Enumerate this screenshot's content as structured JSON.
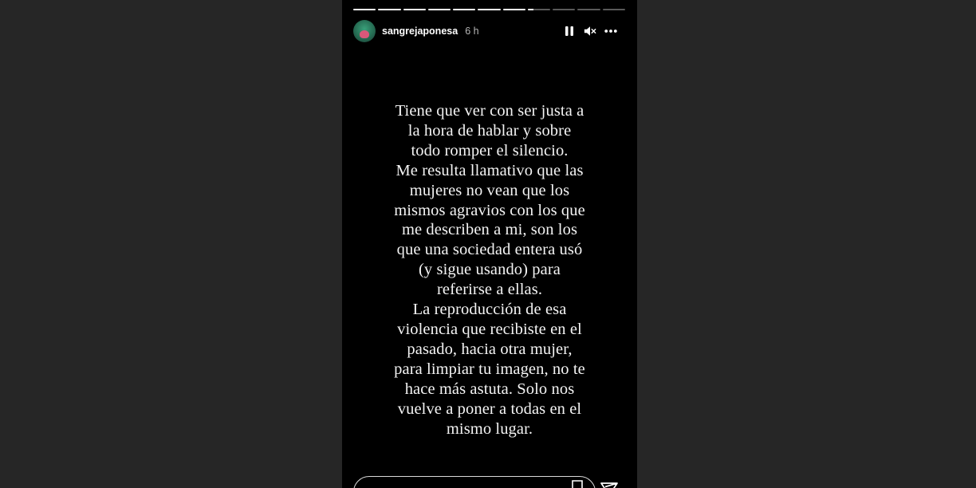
{
  "story": {
    "username": "sangrejaponesa",
    "time_ago": "6 h",
    "progress": {
      "segments_total": 11,
      "segments_complete": 7,
      "current_segment_fraction": 0.25
    },
    "controls": {
      "pause_icon": "pause-icon",
      "mute_icon": "muted-speaker-icon",
      "more_icon": "more-options-icon"
    },
    "text": "Tiene que ver con ser justa a\nla hora de hablar y sobre\ntodo romper el silencio.\nMe resulta llamativo que las\nmujeres no vean que los\nmismos agravios con los que\nme describen a mi, son los\nque una sociedad entera usó\n(y sigue usando) para\nreferirse a ellas.\nLa reproducción de esa\nviolencia que recibiste en el\npasado, hacia otra mujer,\npara limpiar tu imagen, no te\nhace más astuta. Solo nos\nvuelve a poner a todas en el\nmismo lugar.",
    "reply": {
      "value": "",
      "placeholder": ""
    },
    "colors": {
      "page_background": "#262626",
      "story_background": "#000000",
      "text": "#f4f4f4"
    }
  }
}
